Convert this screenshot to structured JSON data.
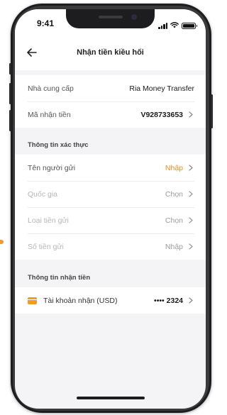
{
  "status_bar": {
    "time": "9:41"
  },
  "header": {
    "title": "Nhận tiền kiều hối"
  },
  "summary": [
    {
      "label": "Nhà cung cấp",
      "value": "Ria Money Transfer"
    },
    {
      "label": "Mã nhận tiền",
      "value": "V928733653"
    }
  ],
  "auth_section": {
    "title": "Thông tin xác thực",
    "rows": [
      {
        "label": "Tên người gửi",
        "value": "Nhập"
      },
      {
        "label": "Quốc gia",
        "value": "Chọn"
      },
      {
        "label": "Loại tiền gửi",
        "value": "Chọn"
      },
      {
        "label": "Số tiền gửi",
        "value": "Nhập"
      }
    ]
  },
  "receive_section": {
    "title": "Thông tin nhận tiền",
    "account_label": "Tài khoản nhận (USD)",
    "account_value": "•••• 2324"
  },
  "colors": {
    "accent": "#f08c1e",
    "background": "#f4f4f6"
  }
}
